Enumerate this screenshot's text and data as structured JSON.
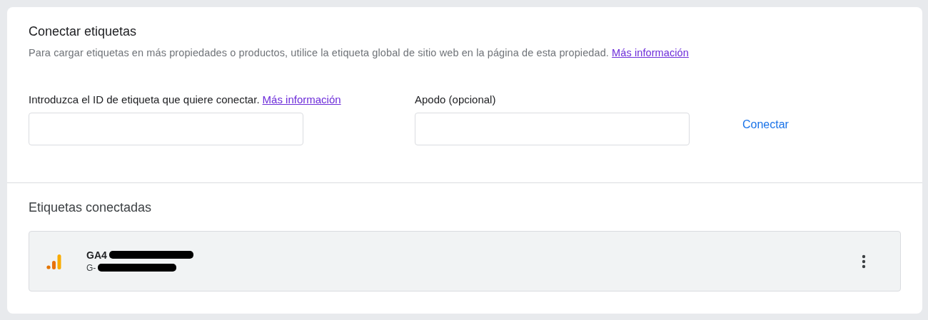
{
  "connect": {
    "title": "Conectar etiquetas",
    "description": "Para cargar etiquetas en más propiedades o productos, utilice la etiqueta global de sitio web en la página de esta propiedad.",
    "description_link": "Más información",
    "fields": [
      {
        "label": "Introduzca el ID de etiqueta que quiere conectar.",
        "link": "Más información"
      },
      {
        "label": "Apodo (opcional)"
      }
    ],
    "button": "Conectar"
  },
  "connected": {
    "title": "Etiquetas conectadas",
    "tags": [
      {
        "name": "GA4",
        "id": "G-",
        "redacted": true
      }
    ]
  }
}
